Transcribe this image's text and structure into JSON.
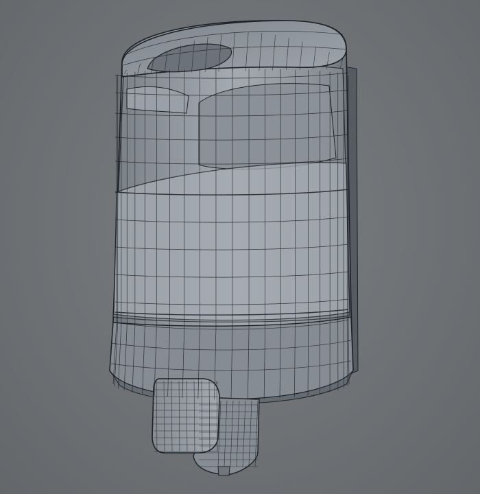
{
  "scene": {
    "subject": "soap-dispenser-wireframe",
    "colors": {
      "background": "#6e7275",
      "body_fill": "#8d949b",
      "body_dark": "#5f666d",
      "window_fill": "#9aa2a9",
      "wire": "#1e2227",
      "liquid": "#a3aab1",
      "button_fill": "#949ba2"
    }
  }
}
